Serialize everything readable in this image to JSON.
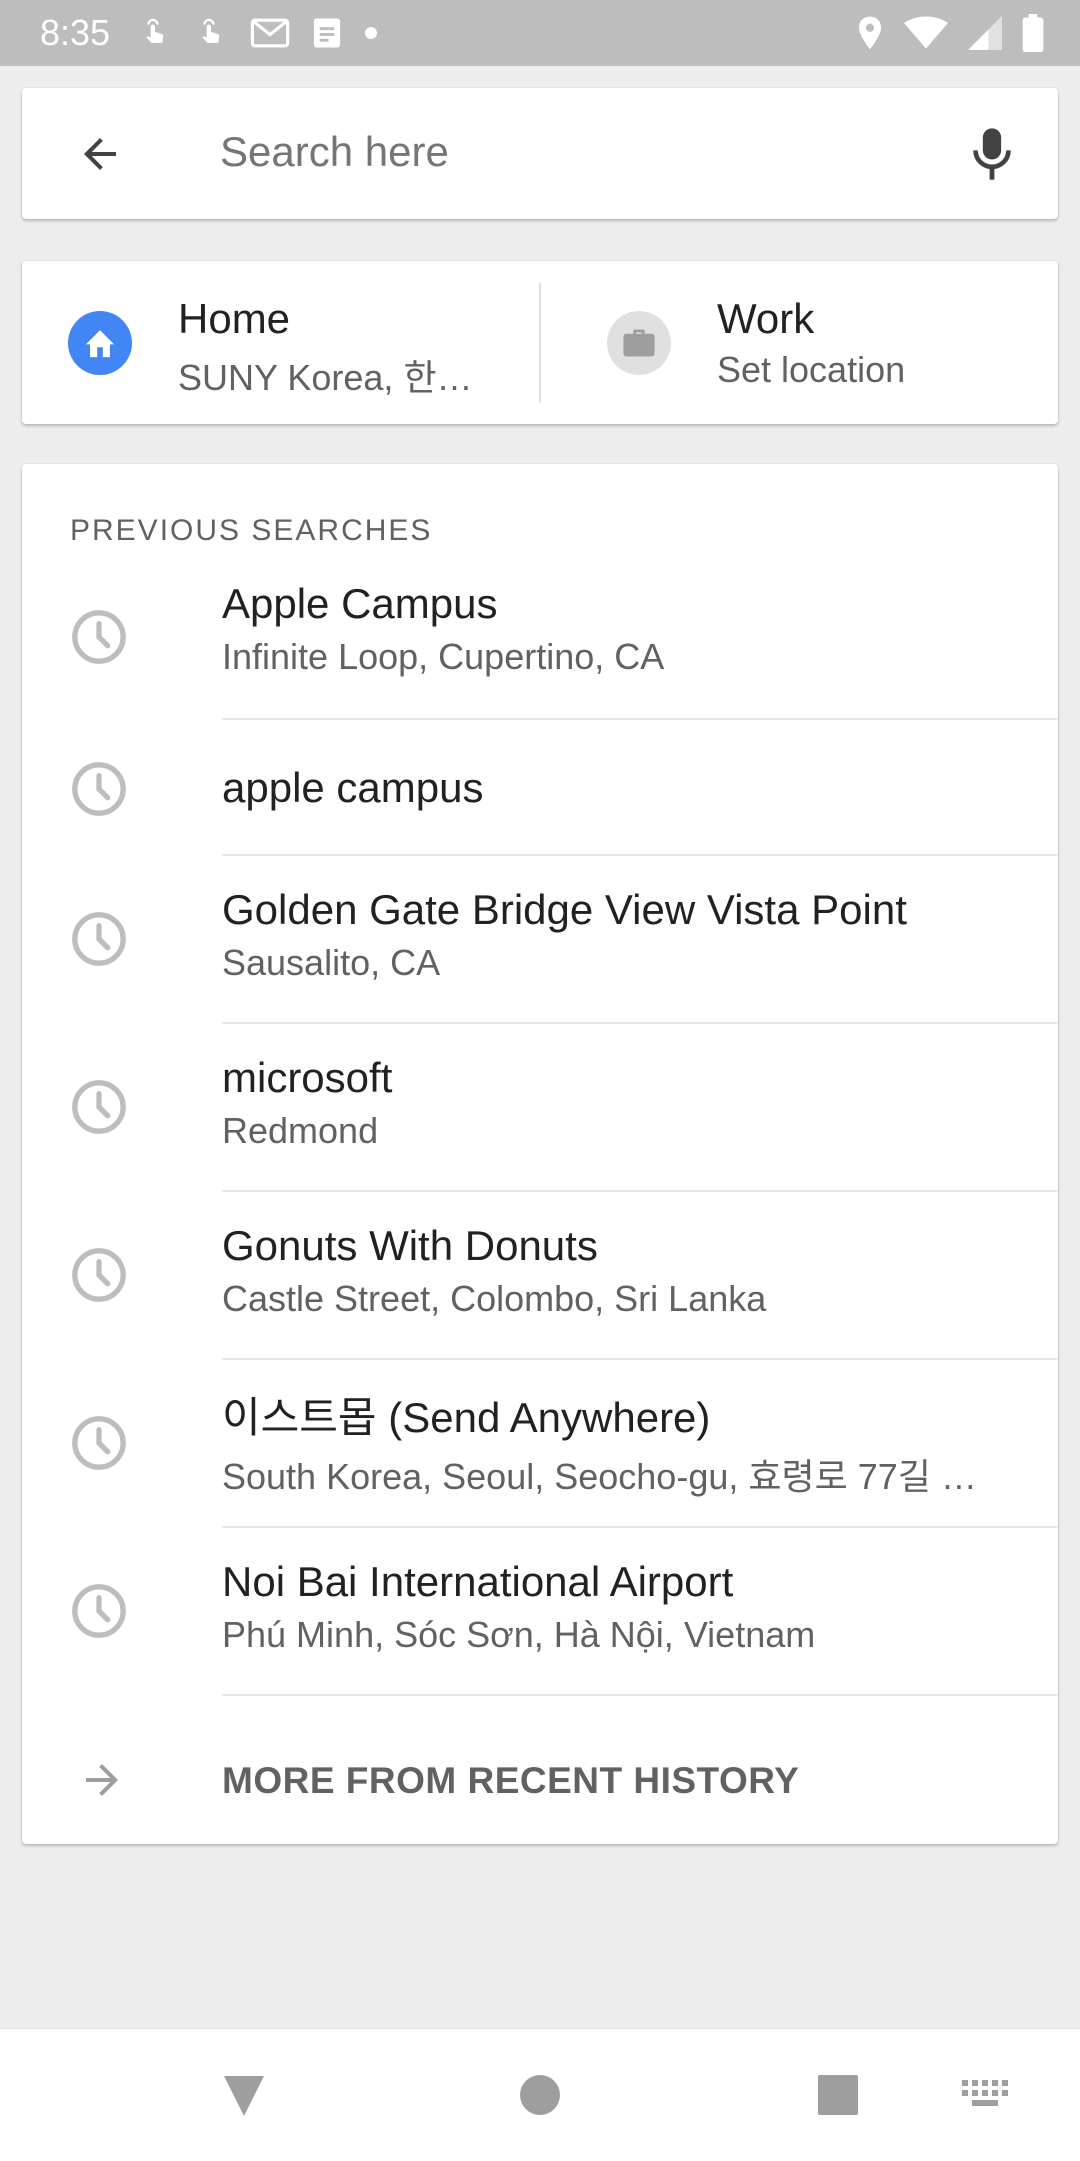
{
  "status_bar": {
    "time": "8:35",
    "left_icons": [
      "touch-icon",
      "touch-icon",
      "gmail-icon",
      "notes-icon",
      "dot-icon"
    ],
    "right_icons": [
      "location-icon",
      "wifi-icon",
      "signal-icon",
      "battery-icon"
    ]
  },
  "search": {
    "placeholder": "Search here",
    "back_icon": "arrow-back-icon",
    "mic_icon": "mic-icon"
  },
  "places": {
    "home": {
      "title": "Home",
      "subtitle": "SUNY Korea, 한…",
      "icon": "home-icon",
      "color": "#4285f4"
    },
    "work": {
      "title": "Work",
      "subtitle": "Set location",
      "icon": "briefcase-icon",
      "color": "#e0e0e0"
    }
  },
  "history": {
    "section_label": "PREVIOUS SEARCHES",
    "items": [
      {
        "name": "Apple Campus",
        "address": "Infinite Loop, Cupertino, CA"
      },
      {
        "name": "apple campus",
        "address": ""
      },
      {
        "name": "Golden Gate Bridge View Vista Point",
        "address": "Sausalito, CA"
      },
      {
        "name": "microsoft",
        "address": "Redmond"
      },
      {
        "name": "Gonuts With Donuts",
        "address": "Castle Street, Colombo, Sri Lanka"
      },
      {
        "name": "이스트몹 (Send Anywhere)",
        "address": "South Korea, Seoul, Seocho-gu, 효령로 77길 …"
      },
      {
        "name": "Noi Bai International Airport",
        "address": "Phú Minh, Sóc Sơn, Hà Nội, Vietnam"
      }
    ],
    "more_label": "MORE FROM RECENT HISTORY"
  },
  "nav": {
    "back": "nav-back-icon",
    "home": "nav-home-icon",
    "recents": "nav-recents-icon",
    "keyboard": "keyboard-icon"
  }
}
